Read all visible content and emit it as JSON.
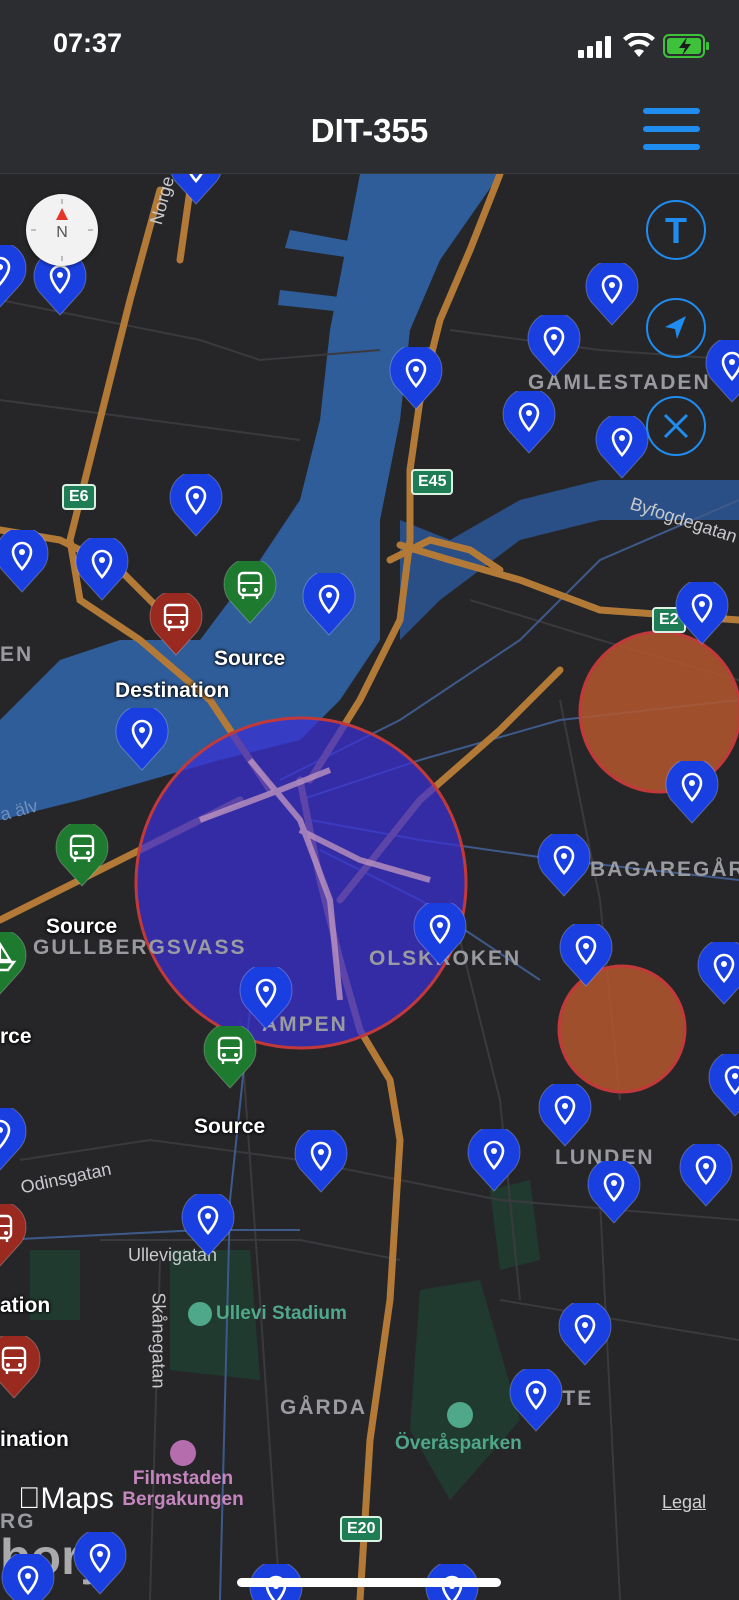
{
  "status_bar": {
    "time": "07:37"
  },
  "header": {
    "title": "DIT-355",
    "menu_icon": "hamburger-menu-icon"
  },
  "map_controls": {
    "compass_letter": "N",
    "transport_button_letter": "T",
    "locate_icon": "location-arrow-icon",
    "clear_icon": "close-icon"
  },
  "colors": {
    "accent": "#1f8cf0",
    "pin": "#1a3fe0",
    "source": "#1e7a2e",
    "destination": "#9a2a1f",
    "selection_circle": "#3a2fd6",
    "heat_circle": "#b5572b"
  },
  "places": {
    "source_1": "Source",
    "destination_1": "Destination",
    "source_2": "Source",
    "source_3": "Source",
    "source_partial": "rce",
    "destination_partial_1": "ation",
    "destination_partial_2": "ination"
  },
  "map_labels": {
    "gamlestaden": "GAMLESTADEN",
    "bagaregarden": "BAGAREGÅR",
    "gullbergsvass": "GULLBERGSVASS",
    "olskroken": "OLSKROKEN",
    "gamlestaden_partial": "EN",
    "lunden": "LUNDEN",
    "rye": "RYTE",
    "garda": "GÅRDA",
    "rg": "RG",
    "stampen": "AMPEN",
    "byfogdegatan": "Byfogdegatan",
    "odinsgatan": "Odinsgatan",
    "ullevigatan": "Ullevigatan",
    "skanegatan": "Skånegatan",
    "norge": "Norge",
    "ullevi": "Ullevi Stadium",
    "overasparken": "Överåsparken",
    "filmstaden": "Filmstaden Bergakungen",
    "alv": "a älv",
    "city": "bory"
  },
  "shields": {
    "e6": "E6",
    "e45": "E45",
    "e20": "E20",
    "e2": "E2"
  },
  "footer": {
    "maps_logo": "Maps",
    "legal": "Legal"
  }
}
